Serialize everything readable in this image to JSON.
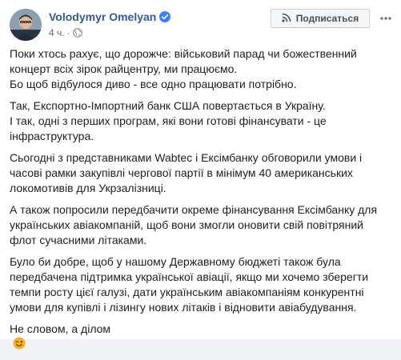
{
  "post": {
    "author": "Volodymyr Omelyan",
    "verified_icon": "verified-badge-icon",
    "timestamp": "4 ч.",
    "separator": "·",
    "audience_icon": "globe-icon",
    "subscribe_label": "Подписаться",
    "subscribe_icon": "rss-icon",
    "more_icon": "more-options-icon",
    "paragraphs": [
      {
        "lines": [
          "Поки хтось рахує, що дорожче: військовий парад чи божественний",
          "концерт всіх зірок райцентру, ми працюємо.",
          "Бо щоб відбулося диво - все одно працювати потрібно."
        ]
      },
      {
        "lines": [
          "Так, Експортно-Імпортний банк США повертається в Україну.",
          "І так, одні з перших програм, які вони готові фінансувати - це",
          "інфраструктура."
        ]
      },
      {
        "lines": [
          "Сьогодні з представниками Wabtec і Ексімбанку обговорили умови і",
          "часові рамки закупівлі чергової партії в мінімум 40 американських",
          "локомотивів для Укрзалізниці."
        ]
      },
      {
        "lines": [
          "А також попросили передбачити окреме фінансування Ексімбанку для",
          "українських авіакомпаній, щоб вони змогли оновити свій повітряний",
          "флот сучасними літаками."
        ]
      },
      {
        "lines": [
          "Було би добре, щоб у нашому Державному бюджеті також була",
          "передбачена підтримка української авіації, якщо ми хочемо зберегти",
          "темпи росту цієї галузі, дати українським авіакомпаніям конкурентні",
          "умови для купівлі і лізингу нових літаків і відновити авіабудування."
        ]
      },
      {
        "lines": [
          "Не словом, а ділом"
        ],
        "emoji": "winking-face-emoji"
      }
    ]
  },
  "colors": {
    "author_link": "#365899",
    "text": "#1c1e21",
    "meta": "#616770",
    "verified": "#4080ff",
    "button_bg": "#f5f6f7",
    "button_border": "#ccd0d5",
    "emoji": "#f7b125"
  }
}
